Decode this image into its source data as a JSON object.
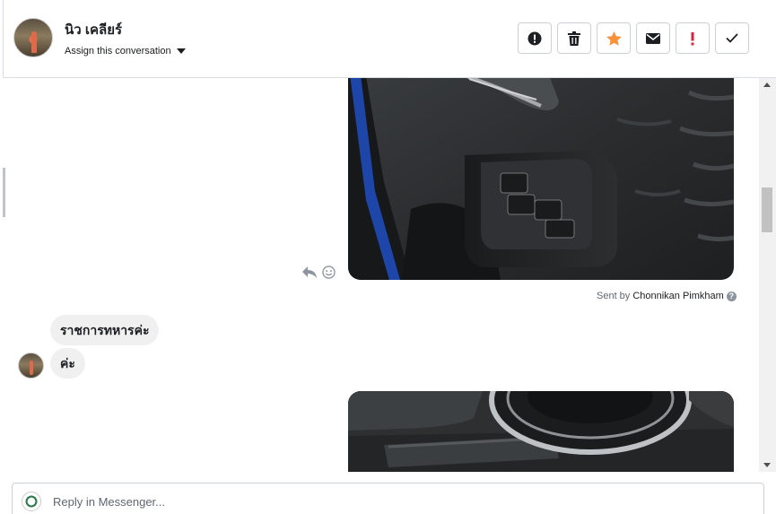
{
  "header": {
    "name": "นิว เคลียร์",
    "assign_label": "Assign this conversation"
  },
  "toolbar": {
    "buttons": [
      {
        "name": "mark-spam",
        "icon": "alert-circle-icon"
      },
      {
        "name": "delete",
        "icon": "trash-icon"
      },
      {
        "name": "star",
        "icon": "star-icon",
        "color": "#f7923b"
      },
      {
        "name": "mark-unread",
        "icon": "envelope-icon"
      },
      {
        "name": "follow-up",
        "icon": "exclamation-icon",
        "color": "#e41e3f"
      },
      {
        "name": "mark-done",
        "icon": "check-icon"
      }
    ]
  },
  "thread": {
    "sent_by_prefix": "Sent by",
    "sent_by_name": "Chonnikan Pimkham",
    "messages": [
      {
        "text": "ราชการทหารค่ะ"
      },
      {
        "text": "ค่ะ"
      }
    ]
  },
  "composer": {
    "placeholder": "Reply in Messenger..."
  }
}
